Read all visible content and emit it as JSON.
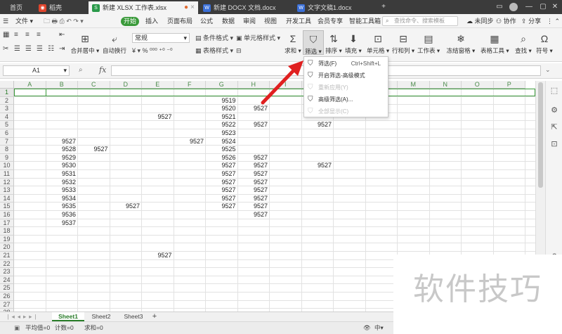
{
  "tabs": [
    {
      "label": "首页",
      "active": false
    },
    {
      "label": "稻壳",
      "active": false
    },
    {
      "label": "新建 XLSX 工作表.xlsx",
      "active": true
    },
    {
      "label": "新建 DOCX 文档.docx",
      "active": false
    },
    {
      "label": "文字文稿1.docx",
      "active": false
    }
  ],
  "menu": {
    "file": "文件",
    "start": "开始",
    "items": [
      "插入",
      "页面布局",
      "公式",
      "数据",
      "审阅",
      "视图",
      "开发工具",
      "会员专享",
      "智能工具箱"
    ],
    "search_placeholder": "查找命令、搜索模板",
    "right": [
      "未同步",
      "协作",
      "分享"
    ]
  },
  "ribbon": {
    "format_painter": "格式刷",
    "merge_center": "合并居中",
    "wrap_text": "自动换行",
    "number_format": "常规",
    "cond_format": "条件格式",
    "table_style": "表格样式",
    "cell_style": "单元格样式",
    "sum": "求和",
    "filter": "筛选",
    "sort": "排序",
    "fill": "填充",
    "cell": "单元格",
    "row_col": "行和列",
    "worksheet": "工作表",
    "freeze": "冻结窗格",
    "table_tools": "表格工具",
    "find": "查找",
    "symbol": "符号"
  },
  "formula_bar": {
    "name_box": "A1",
    "fx": "fx",
    "value": ""
  },
  "columns": [
    "A",
    "B",
    "C",
    "D",
    "E",
    "F",
    "G",
    "H",
    "I",
    "J",
    "K",
    "L",
    "M",
    "N",
    "O",
    "P"
  ],
  "rows": [
    "1",
    "2",
    "3",
    "4",
    "5",
    "6",
    "7",
    "8",
    "9",
    "10",
    "11",
    "12",
    "13",
    "14",
    "15",
    "16",
    "17",
    "18",
    "19",
    "20",
    "21",
    "22",
    "23",
    "24",
    "25",
    "26",
    "27",
    "28"
  ],
  "cells": [
    {
      "col": "G",
      "row": 2,
      "value": "9519"
    },
    {
      "col": "G",
      "row": 3,
      "value": "9520"
    },
    {
      "col": "H",
      "row": 3,
      "value": "9527"
    },
    {
      "col": "E",
      "row": 4,
      "value": "9527"
    },
    {
      "col": "G",
      "row": 4,
      "value": "9521"
    },
    {
      "col": "G",
      "row": 5,
      "value": "9522"
    },
    {
      "col": "H",
      "row": 5,
      "value": "9527"
    },
    {
      "col": "J",
      "row": 5,
      "value": "9527"
    },
    {
      "col": "G",
      "row": 6,
      "value": "9523"
    },
    {
      "col": "B",
      "row": 7,
      "value": "9527"
    },
    {
      "col": "F",
      "row": 7,
      "value": "9527"
    },
    {
      "col": "G",
      "row": 7,
      "value": "9524"
    },
    {
      "col": "B",
      "row": 8,
      "value": "9528"
    },
    {
      "col": "C",
      "row": 8,
      "value": "9527"
    },
    {
      "col": "G",
      "row": 8,
      "value": "9525"
    },
    {
      "col": "B",
      "row": 9,
      "value": "9529"
    },
    {
      "col": "G",
      "row": 9,
      "value": "9526"
    },
    {
      "col": "H",
      "row": 9,
      "value": "9527"
    },
    {
      "col": "B",
      "row": 10,
      "value": "9530"
    },
    {
      "col": "G",
      "row": 10,
      "value": "9527"
    },
    {
      "col": "H",
      "row": 10,
      "value": "9527"
    },
    {
      "col": "J",
      "row": 10,
      "value": "9527"
    },
    {
      "col": "B",
      "row": 11,
      "value": "9531"
    },
    {
      "col": "G",
      "row": 11,
      "value": "9527"
    },
    {
      "col": "H",
      "row": 11,
      "value": "9527"
    },
    {
      "col": "B",
      "row": 12,
      "value": "9532"
    },
    {
      "col": "G",
      "row": 12,
      "value": "9527"
    },
    {
      "col": "H",
      "row": 12,
      "value": "9527"
    },
    {
      "col": "B",
      "row": 13,
      "value": "9533"
    },
    {
      "col": "G",
      "row": 13,
      "value": "9527"
    },
    {
      "col": "H",
      "row": 13,
      "value": "9527"
    },
    {
      "col": "B",
      "row": 14,
      "value": "9534"
    },
    {
      "col": "G",
      "row": 14,
      "value": "9527"
    },
    {
      "col": "H",
      "row": 14,
      "value": "9527"
    },
    {
      "col": "B",
      "row": 15,
      "value": "9535"
    },
    {
      "col": "D",
      "row": 15,
      "value": "9527"
    },
    {
      "col": "G",
      "row": 15,
      "value": "9527"
    },
    {
      "col": "H",
      "row": 15,
      "value": "9527"
    },
    {
      "col": "B",
      "row": 16,
      "value": "9536"
    },
    {
      "col": "H",
      "row": 16,
      "value": "9527"
    },
    {
      "col": "B",
      "row": 17,
      "value": "9537"
    },
    {
      "col": "E",
      "row": 21,
      "value": "9527"
    }
  ],
  "filter_menu": [
    {
      "label": "筛选(F)",
      "shortcut": "Ctrl+Shift+L",
      "disabled": false
    },
    {
      "label": "开启筛选-高级模式",
      "shortcut": "",
      "disabled": false
    },
    {
      "label": "重新应用(Y)",
      "shortcut": "",
      "disabled": true
    },
    {
      "label": "高级筛选(A)...",
      "shortcut": "",
      "disabled": false
    },
    {
      "label": "全部显示(C)",
      "shortcut": "",
      "disabled": true
    }
  ],
  "sheets": [
    "Sheet1",
    "Sheet2",
    "Sheet3"
  ],
  "status": {
    "avg": "平均值=0",
    "count": "计数=0",
    "sum": "求和=0"
  },
  "watermark": "软件技巧",
  "colors": {
    "accent": "#3a9a3a",
    "arrow": "#e02020"
  }
}
